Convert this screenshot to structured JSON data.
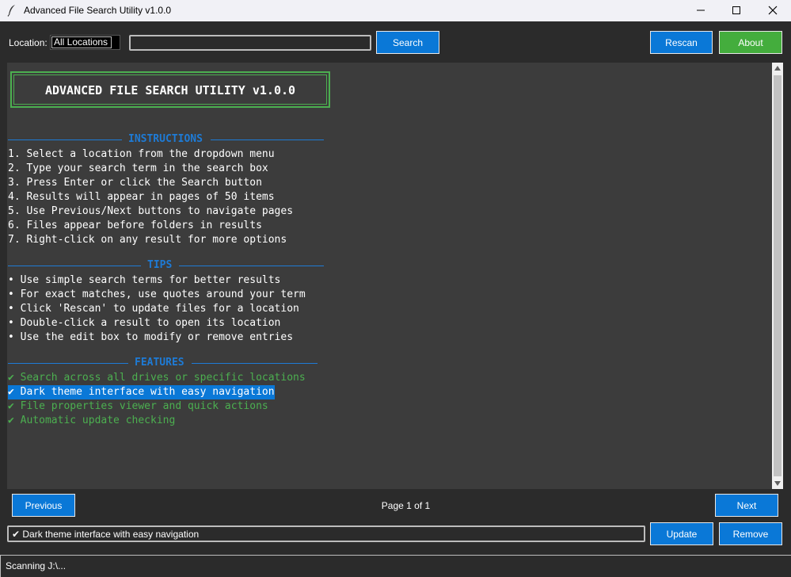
{
  "window": {
    "title": "Advanced File Search Utility v1.0.0"
  },
  "toolbar": {
    "location_label": "Location:",
    "location_value": "All Locations",
    "search_value": "",
    "search_button": "Search",
    "rescan_button": "Rescan",
    "about_button": "About"
  },
  "content": {
    "banner": "ADVANCED FILE SEARCH UTILITY v1.0.0",
    "instructions_heading": "INSTRUCTIONS",
    "instructions": [
      "1. Select a location from the dropdown menu",
      "2. Type your search term in the search box",
      "3. Press Enter or click the Search button",
      "4. Results will appear in pages of 50 items",
      "5. Use Previous/Next buttons to navigate pages",
      "6. Files appear before folders in results",
      "7. Right-click on any result for more options"
    ],
    "tips_heading": "TIPS",
    "tips": [
      "• Use simple search terms for better results",
      "• For exact matches, use quotes around your term",
      "• Click 'Rescan' to update files for a location",
      "• Double-click a result to open its location",
      "• Use the edit box to modify or remove entries"
    ],
    "features_heading": "FEATURES",
    "features": [
      "✔ Search across all drives or specific locations",
      "✔ Dark theme interface with easy navigation",
      "✔ File properties viewer and quick actions",
      "✔ Automatic update checking"
    ]
  },
  "nav": {
    "previous_button": "Previous",
    "page_label": "Page 1 of 1",
    "next_button": "Next"
  },
  "edit": {
    "value": "✔ Dark theme interface with easy navigation",
    "update_button": "Update",
    "remove_button": "Remove"
  },
  "status": {
    "text": "Scanning J:\\..."
  },
  "colors": {
    "accent_blue": "#0a78d7",
    "accent_green": "#44ad3d",
    "heading_blue": "#1e7bd6",
    "feature_green": "#4caf50"
  }
}
